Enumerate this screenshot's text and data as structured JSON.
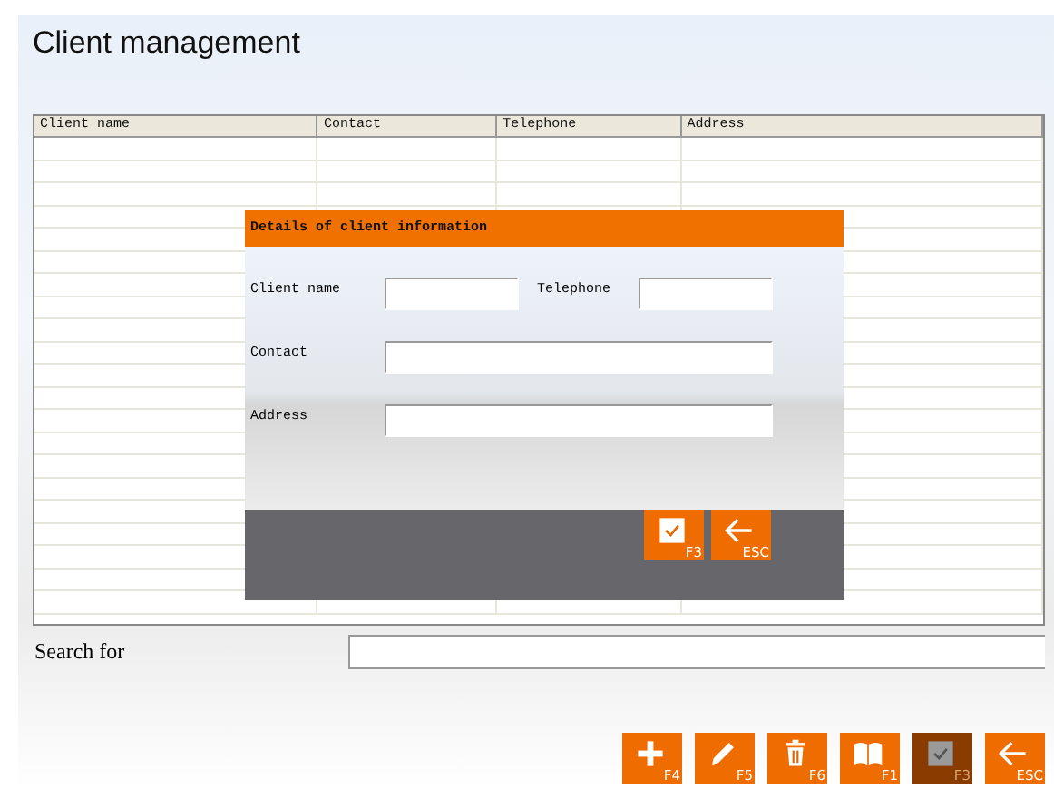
{
  "title": "Client management",
  "table": {
    "columns": [
      "Client name",
      "Contact",
      "Telephone",
      "Address"
    ]
  },
  "dialog": {
    "title": "Details of client information",
    "rows": [
      [
        {
          "label": "Client name"
        },
        {
          "label": "Telephone"
        }
      ],
      [
        {
          "label": "Contact"
        }
      ],
      [
        {
          "label": "Address"
        }
      ]
    ],
    "buttons": [
      {
        "kind": "check",
        "key": "F3",
        "disabled": false
      },
      {
        "kind": "back",
        "key": "ESC",
        "disabled": false
      }
    ]
  },
  "search": {
    "label": "Search for"
  },
  "toolbar": [
    {
      "kind": "plus",
      "key": "F4",
      "disabled": false
    },
    {
      "kind": "pencil",
      "key": "F5",
      "disabled": false
    },
    {
      "kind": "trash",
      "key": "F6",
      "disabled": false
    },
    {
      "kind": "book",
      "key": "F1",
      "disabled": false
    },
    {
      "kind": "check",
      "key": "F3",
      "disabled": true
    },
    {
      "kind": "back",
      "key": "ESC",
      "disabled": false
    }
  ]
}
